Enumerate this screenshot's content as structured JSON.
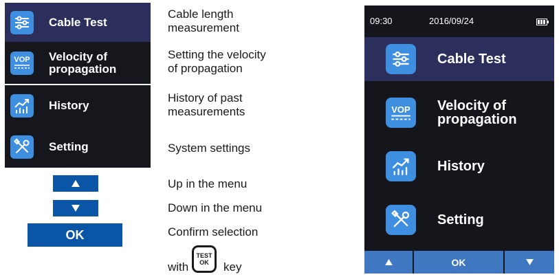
{
  "menu": {
    "items": [
      {
        "label": "Cable Test",
        "icon": "sliders-icon",
        "description": "Cable length\nmeasurement"
      },
      {
        "label": "Velocity of\npropagation",
        "icon": "vop-icon",
        "vop_text": "VOP",
        "description": "Setting the velocity\nof propagation"
      },
      {
        "label": "History",
        "icon": "chart-icon",
        "description": "History of past\nmeasurements"
      },
      {
        "label": "Setting",
        "icon": "tools-icon",
        "description": "System settings"
      }
    ]
  },
  "keys": {
    "up_desc": "Up in the menu",
    "down_desc": "Down in the menu",
    "ok_label": "OK",
    "confirm_line1": "Confirm selection",
    "confirm_with": "with",
    "confirm_key": "key",
    "test_key_line1": "TEST",
    "test_key_line2": "OK"
  },
  "device": {
    "status": {
      "time": "09:30",
      "date": "2016/09/24"
    },
    "softkeys": {
      "ok": "OK"
    }
  },
  "colors": {
    "menu_bg": "#15171d",
    "selected_bg": "#2c2f5c",
    "icon_blue": "#3f8fe0",
    "key_blue": "#0b55a6",
    "softkey_blue": "#3f78c0"
  }
}
